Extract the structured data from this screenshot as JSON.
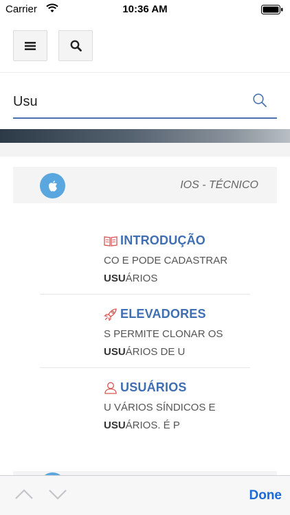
{
  "status_bar": {
    "carrier": "Carrier",
    "time": "10:36 AM"
  },
  "search": {
    "value": "Usu"
  },
  "section": {
    "title": "IOS - TÉCNICO",
    "icon": "apple-icon"
  },
  "results": [
    {
      "icon": "book-icon",
      "title": "INTRODUÇÃO",
      "line1": "CO E PODE CADASTRAR",
      "line2_highlight": "USU",
      "line2_rest": "ÁRIOS"
    },
    {
      "icon": "rocket-icon",
      "title": "ELEVADORES",
      "line1": "S PERMITE CLONAR OS",
      "line2_highlight": "USU",
      "line2_rest": "ÁRIOS DE U"
    },
    {
      "icon": "user-icon",
      "title": "USUÁRIOS",
      "line1": "U VÁRIOS SÍNDICOS E",
      "line2_highlight": "USU",
      "line2_rest": "ÁRIOS. É P"
    }
  ],
  "keyboard_toolbar": {
    "done_label": "Done"
  },
  "colors": {
    "accent": "#3f6eb3",
    "icon_red": "#d9534f",
    "apple_circle": "#5aa6df",
    "done": "#1a6ad8"
  }
}
